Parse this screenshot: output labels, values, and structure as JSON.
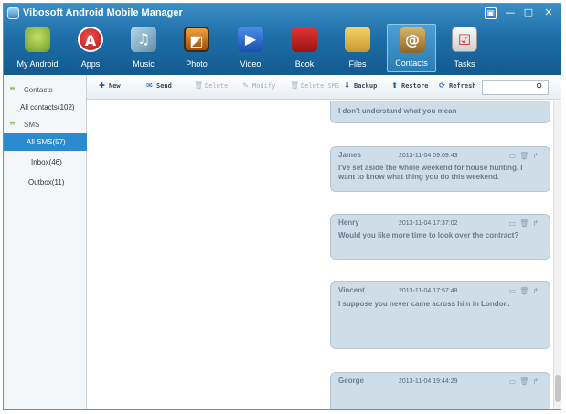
{
  "app": {
    "title": "Vibosoft Android Mobile Manager"
  },
  "window_controls": {
    "menu": "▣",
    "minimize": "—",
    "maximize": "□",
    "close": "✕"
  },
  "nav": [
    {
      "label": "My Android",
      "icon": "android-icon",
      "glyph": ""
    },
    {
      "label": "Apps",
      "icon": "apps-icon",
      "glyph": "A"
    },
    {
      "label": "Music",
      "icon": "music-icon",
      "glyph": "♫"
    },
    {
      "label": "Photo",
      "icon": "photo-icon",
      "glyph": "◩"
    },
    {
      "label": "Video",
      "icon": "video-icon",
      "glyph": "▶"
    },
    {
      "label": "Book",
      "icon": "book-icon",
      "glyph": ""
    },
    {
      "label": "Files",
      "icon": "folder-icon",
      "glyph": ""
    },
    {
      "label": "Contacts",
      "icon": "contacts-icon",
      "glyph": "@"
    },
    {
      "label": "Tasks",
      "icon": "tasks-icon",
      "glyph": "☑"
    }
  ],
  "active_nav": "Contacts",
  "toolbar": {
    "new": "New",
    "send": "Send",
    "delete": "Delete",
    "modify": "Modify",
    "delete_sms": "Delete SMS",
    "backup": "Backup",
    "restore": "Restore",
    "refresh": "Refresh",
    "search_placeholder": ""
  },
  "sidebar": {
    "contacts_group": "Contacts",
    "all_contacts": "All contacts(102)",
    "sms_group": "SMS",
    "all_sms": "All SMS(57)",
    "inbox": "Inbox(46)",
    "outbox": "Outbox(11)"
  },
  "messages": [
    {
      "sender": "",
      "time": "",
      "body": "I don't understand what you mean"
    },
    {
      "sender": "James",
      "time": "2013-11-04 09:09:43",
      "body": "I've set aside the whole weekend for house hunting. I want to know what thing you do this weekend."
    },
    {
      "sender": "Henry",
      "time": "2013-11-04 17:37:02",
      "body": "Would you like more time to look over the contract?"
    },
    {
      "sender": "Vincent",
      "time": "2013-11-04 17:57:48",
      "body": "I suppose you never came across him in London."
    },
    {
      "sender": "George",
      "time": "2013-11-04 19:44:29",
      "body": ""
    }
  ],
  "colors": {
    "header": "#1f6fa8",
    "selected": "#2a8bd0",
    "bubble": "#cfdde8"
  }
}
